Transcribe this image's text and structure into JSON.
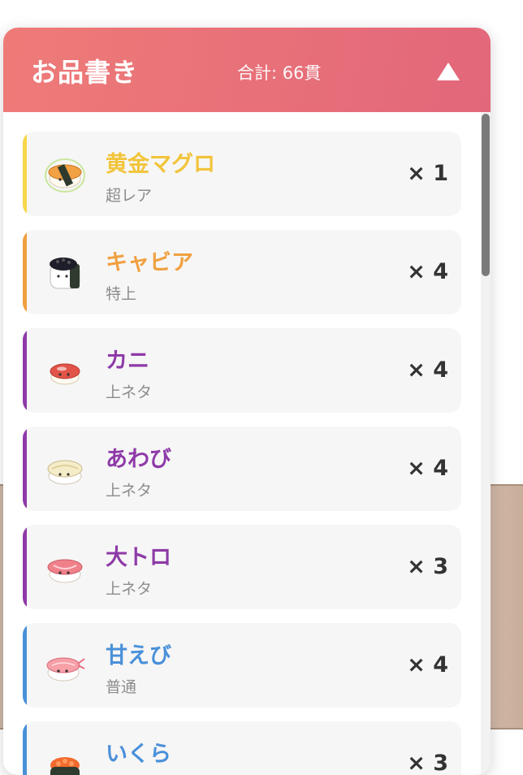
{
  "panel": {
    "title": "お品書き",
    "total": "合計: 66貫"
  },
  "items": [
    {
      "name": "黄金マグロ",
      "grade": "超レア",
      "qty": "× 1",
      "color": "#f5c53a",
      "icon": "golden-tuna-sushi-icon"
    },
    {
      "name": "キャビア",
      "grade": "特上",
      "qty": "× 4",
      "color": "#f0a040",
      "icon": "caviar-gunkan-icon"
    },
    {
      "name": "カニ",
      "grade": "上ネタ",
      "qty": "× 4",
      "color": "#8e3aa8",
      "icon": "crab-sushi-icon"
    },
    {
      "name": "あわび",
      "grade": "上ネタ",
      "qty": "× 4",
      "color": "#8e3aa8",
      "icon": "abalone-sushi-icon"
    },
    {
      "name": "大トロ",
      "grade": "上ネタ",
      "qty": "× 3",
      "color": "#8e3aa8",
      "icon": "otoro-sushi-icon"
    },
    {
      "name": "甘えび",
      "grade": "普通",
      "qty": "× 4",
      "color": "#4a90d9",
      "icon": "sweet-shrimp-sushi-icon"
    },
    {
      "name": "いくら",
      "grade": "",
      "qty": "× 3",
      "color": "#4a90d9",
      "icon": "ikura-gunkan-icon"
    }
  ]
}
